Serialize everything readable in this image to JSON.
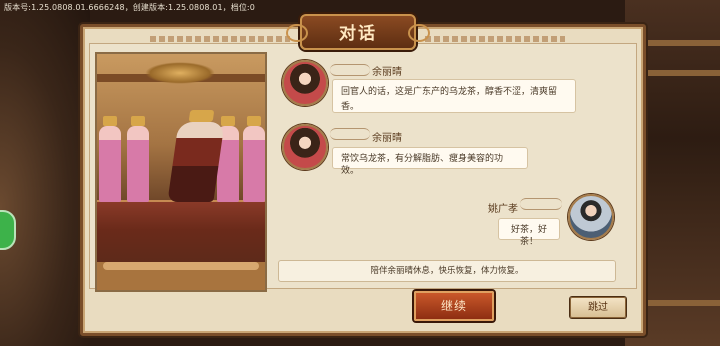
{
  "version_info": "版本号:1.25.0808.01.6666248，创建版本:1.25.0808.01，档位:0",
  "dialog": {
    "title": "对话",
    "entries": [
      {
        "speaker": "余丽晴",
        "text": "回官人的话，这是广东产的乌龙茶，醇香不涩，清爽留香。"
      },
      {
        "speaker": "余丽晴",
        "text": "常饮乌龙茶，有分解脂肪、瘦身美容的功效。"
      },
      {
        "speaker": "姚广孝",
        "text": "好茶，好茶！"
      }
    ],
    "narration": "陪伴余丽晴休息，快乐恢复，体力恢复。"
  },
  "buttons": {
    "continue_label": "继续",
    "skip_label": "跳过"
  },
  "icons": {
    "avatar_female": "portrait-female",
    "avatar_male": "portrait-male"
  },
  "colors": {
    "panel_bg": "#e9dcc0",
    "accent": "#8e2e12",
    "frame": "#7a4e2a"
  }
}
